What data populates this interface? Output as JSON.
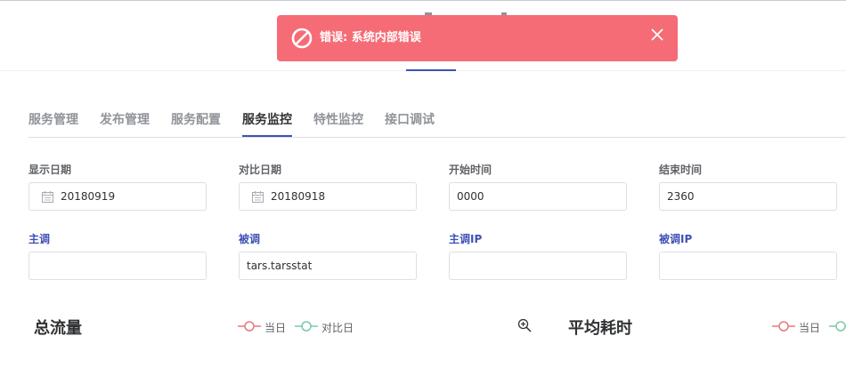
{
  "toast": {
    "message": "错误: 系统内部错误",
    "color": "#f56c76"
  },
  "tabs": [
    {
      "label": "服务管理",
      "active": false
    },
    {
      "label": "发布管理",
      "active": false
    },
    {
      "label": "服务配置",
      "active": false
    },
    {
      "label": "服务监控",
      "active": true
    },
    {
      "label": "特性监控",
      "active": false
    },
    {
      "label": "接口调试",
      "active": false
    }
  ],
  "filters": {
    "display_date": {
      "label": "显示日期",
      "value": "20180919"
    },
    "compare_date": {
      "label": "对比日期",
      "value": "20180918"
    },
    "start_time": {
      "label": "开始时间",
      "value": "0000"
    },
    "end_time": {
      "label": "结束时间",
      "value": "2360"
    },
    "caller": {
      "label": "主调",
      "value": ""
    },
    "callee": {
      "label": "被调",
      "value": "tars.tarsstat"
    },
    "caller_ip": {
      "label": "主调IP",
      "value": ""
    },
    "callee_ip": {
      "label": "被调IP",
      "value": ""
    }
  },
  "charts": [
    {
      "title": "总流量",
      "legend": [
        "当日",
        "对比日"
      ]
    },
    {
      "title": "平均耗时",
      "legend": [
        "当日"
      ]
    }
  ],
  "colors": {
    "accent": "#3f51b5",
    "today_series": "#e8787f",
    "compare_series": "#7cc9a8"
  }
}
